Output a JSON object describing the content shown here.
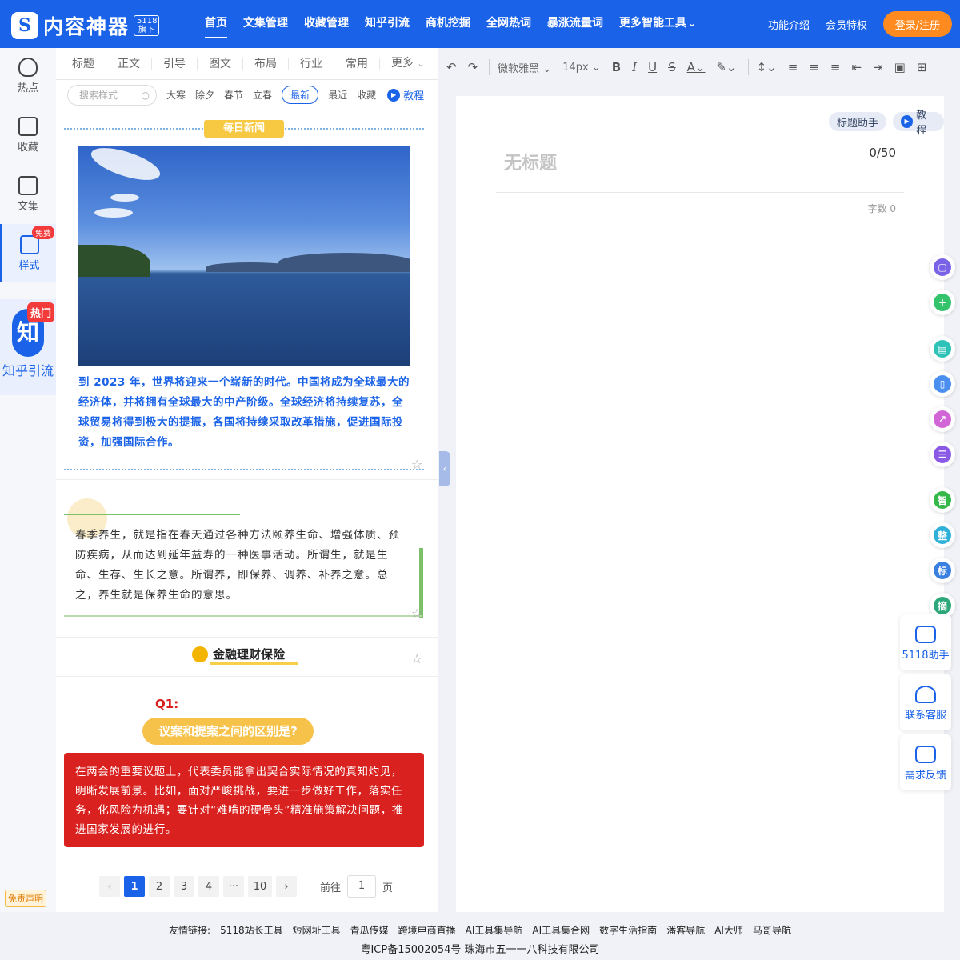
{
  "header": {
    "logo_text": "内容神器",
    "logo_badge": "5118旗下",
    "nav": [
      "首页",
      "文集管理",
      "收藏管理",
      "知乎引流",
      "商机挖掘",
      "全网热词",
      "暴涨流量词",
      "更多智能工具"
    ],
    "links": [
      "功能介绍",
      "会员特权"
    ],
    "login": "登录/注册"
  },
  "leftnav": {
    "items": [
      "热点",
      "收藏",
      "文集",
      "样式"
    ],
    "free_tag": "免费",
    "zhihu_char": "知",
    "hot_tag": "热门",
    "zhihu_label": "知乎引流",
    "disclaimer": "免责声明"
  },
  "style_panel": {
    "tabs": [
      "标题",
      "正文",
      "引导",
      "图文",
      "布局",
      "行业",
      "常用",
      "更多"
    ],
    "search_placeholder": "搜索样式",
    "filters": [
      "大寒",
      "除夕",
      "春节",
      "立春",
      "最新",
      "最近",
      "收藏"
    ],
    "tutorial": "教程",
    "card1_tag": "每日新闻",
    "card1_text": "到 2023 年，世界将迎来一个崭新的时代。中国将成为全球最大的经济体，并将拥有全球最大的中产阶级。全球经济将持续复苏，全球贸易将得到极大的提振，各国将持续采取改革措施，促进国际投资，加强国际合作。",
    "card2_text": "春季养生，就是指在春天通过各种方法颐养生命、增强体质、预防疾病，从而达到延年益寿的一种医事活动。所谓生，就是生命、生存、生长之意。所谓养，即保养、调养、补养之意。总之，养生就是保养生命的意思。",
    "card3_title": "金融理财保险",
    "q1": "Q1:",
    "q_title": "议案和提案之间的区别是?",
    "red_text": "在两会的重要议题上，代表委员能拿出契合实际情况的真知灼见，明晰发展前景。比如，面对严峻挑战，要进一步做好工作，落实任务，化风险为机遇；要针对“难啃的硬骨头”精准施策解决问题，推进国家发展的进行。",
    "pages": [
      "1",
      "2",
      "3",
      "4",
      "···",
      "10"
    ],
    "goto_prefix": "前往",
    "goto_value": "1",
    "goto_suffix": "页"
  },
  "toolbar": {
    "font": "微软雅黑",
    "size": "14px"
  },
  "editor": {
    "helper": "标题助手",
    "tutorial": "教程",
    "title_placeholder": "无标题",
    "title_count": "0/50",
    "wordcount": "字数 0"
  },
  "right_float": {
    "chars": [
      "智",
      "整",
      "标",
      "摘"
    ],
    "cards": [
      "5118助手",
      "联系客服",
      "需求反馈"
    ]
  },
  "footer": {
    "links": [
      "友情链接:",
      "5118站长工具",
      "短网址工具",
      "青瓜传媒",
      "跨境电商直播",
      "AI工具集导航",
      "AI工具集合网",
      "数字生活指南",
      "潘客导航",
      "AI大师",
      "马哥导航"
    ],
    "icp": "粤ICP备15002054号 珠海市五一一八科技有限公司"
  },
  "colors": {
    "brand": "#1a63e8",
    "accent": "#ff8a1f",
    "red": "#d9221f",
    "gold": "#f7c24a"
  }
}
